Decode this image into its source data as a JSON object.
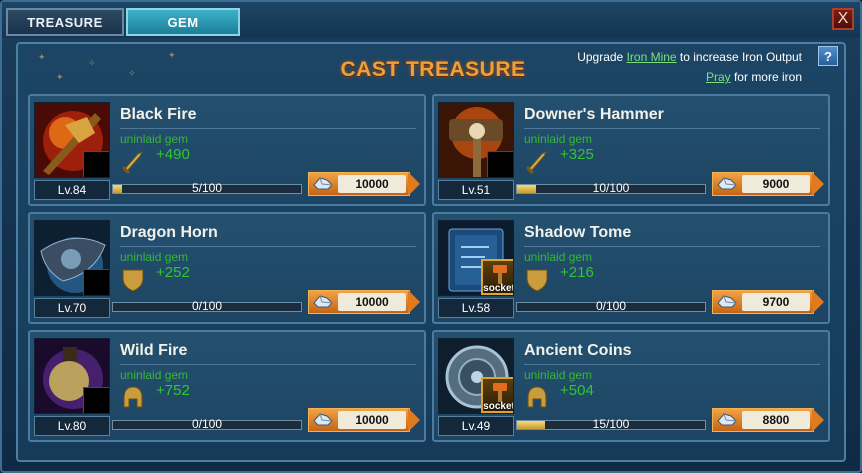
{
  "tabs": [
    {
      "label": "TREASURE",
      "active": false
    },
    {
      "label": "GEM",
      "active": true
    }
  ],
  "window": {
    "close_label": "X"
  },
  "panel": {
    "title": "CAST TREASURE",
    "upgrade_prefix": "Upgrade ",
    "upgrade_link": "Iron Mine",
    "upgrade_suffix": "  to increase Iron Output",
    "pray_link": "Pray",
    "pray_suffix": " for more iron",
    "help_label": "?"
  },
  "items": [
    {
      "name": "Black Fire",
      "level": "Lv.84",
      "gem_text": "uninlaid gem",
      "gem_icon": "sword-icon",
      "bonus": "+490",
      "progress_text": "5/100",
      "progress": 0.05,
      "cost": "10000",
      "socket": false
    },
    {
      "name": "Downer's Hammer",
      "level": "Lv.51",
      "gem_text": "uninlaid gem",
      "gem_icon": "sword-icon",
      "bonus": "+325",
      "progress_text": "10/100",
      "progress": 0.1,
      "cost": "9000",
      "socket": false
    },
    {
      "name": "Dragon Horn",
      "level": "Lv.70",
      "gem_text": "uninlaid gem",
      "gem_icon": "shield-icon",
      "bonus": "+252",
      "progress_text": "0/100",
      "progress": 0.0,
      "cost": "10000",
      "socket": false
    },
    {
      "name": "Shadow Tome",
      "level": "Lv.58",
      "gem_text": "uninlaid gem",
      "gem_icon": "shield-icon",
      "bonus": "+216",
      "progress_text": "0/100",
      "progress": 0.0,
      "cost": "9700",
      "socket": true,
      "socket_label": "socket"
    },
    {
      "name": "Wild Fire",
      "level": "Lv.80",
      "gem_text": "uninlaid gem",
      "gem_icon": "helmet-icon",
      "bonus": "+752",
      "progress_text": "0/100",
      "progress": 0.0,
      "cost": "10000",
      "socket": false
    },
    {
      "name": "Ancient Coins",
      "level": "Lv.49",
      "gem_text": "uninlaid gem",
      "gem_icon": "helmet-icon",
      "bonus": "+504",
      "progress_text": "15/100",
      "progress": 0.15,
      "cost": "8800",
      "socket": true,
      "socket_label": "socket"
    }
  ],
  "colors": {
    "accent": "#f0a03a",
    "gem_green": "#35b835",
    "link": "#79e07b"
  }
}
